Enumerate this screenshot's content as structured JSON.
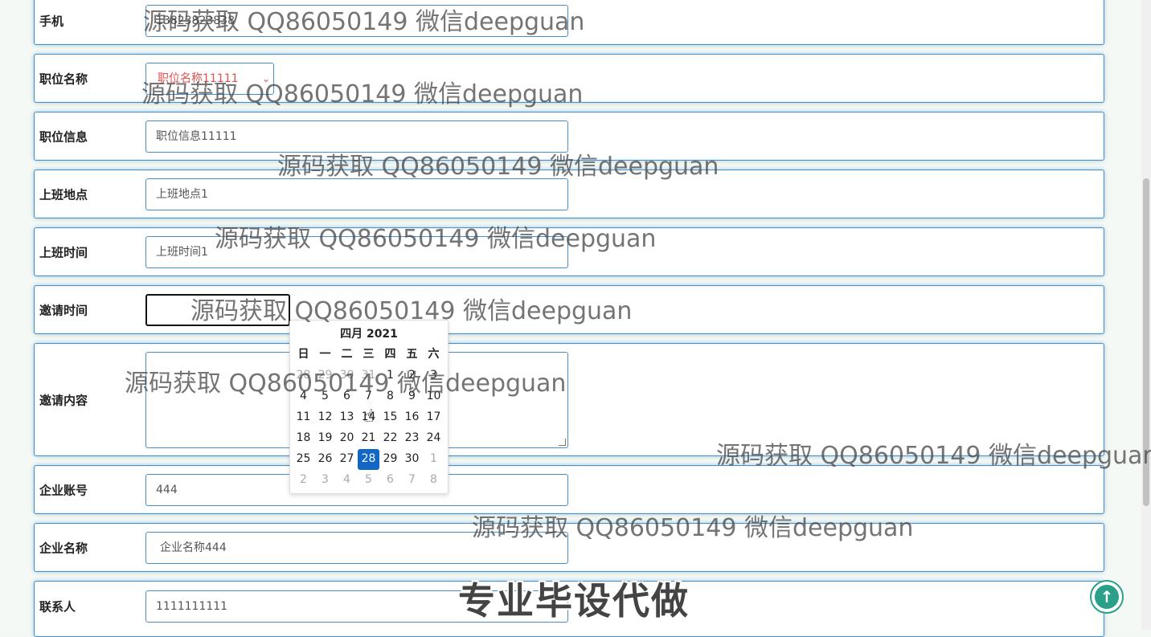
{
  "form": {
    "phone": {
      "label": "手机",
      "value": "13823823838"
    },
    "position_name": {
      "label": "职位名称",
      "selected": "职位名称11111"
    },
    "position_info": {
      "label": "职位信息",
      "value": "职位信息11111"
    },
    "work_location": {
      "label": "上班地点",
      "value": "上班地点1"
    },
    "work_time": {
      "label": "上班时间",
      "value": "上班时间1"
    },
    "invite_time": {
      "label": "邀请时间",
      "value": ""
    },
    "invite_content": {
      "label": "邀请内容",
      "value": ""
    },
    "company_account": {
      "label": "企业账号",
      "value": "444"
    },
    "company_name": {
      "label": "企业名称",
      "value": "企业名称444"
    },
    "contact": {
      "label": "联系人",
      "value": "1111111111"
    }
  },
  "calendar": {
    "title": "四月 2021",
    "weekdays": [
      "日",
      "一",
      "二",
      "三",
      "四",
      "五",
      "六"
    ],
    "weeks": [
      [
        "28",
        "29",
        "30",
        "31",
        "1",
        "2",
        "3"
      ],
      [
        "4",
        "5",
        "6",
        "7",
        "8",
        "9",
        "10"
      ],
      [
        "11",
        "12",
        "13",
        "14",
        "15",
        "16",
        "17"
      ],
      [
        "18",
        "19",
        "20",
        "21",
        "22",
        "23",
        "24"
      ],
      [
        "25",
        "26",
        "27",
        "28",
        "29",
        "30",
        "1"
      ],
      [
        "2",
        "3",
        "4",
        "5",
        "6",
        "7",
        "8"
      ]
    ],
    "selected": "28",
    "accent": "#1166c6"
  },
  "watermark_text": "源码获取 QQ86050149 微信deepguan",
  "banner_text": "专业毕设代做",
  "back_to_top_icon": "arrow-up-icon",
  "colors": {
    "border": "#4a90c8",
    "select_text": "#e05050",
    "back_top": "#2aa08a"
  }
}
